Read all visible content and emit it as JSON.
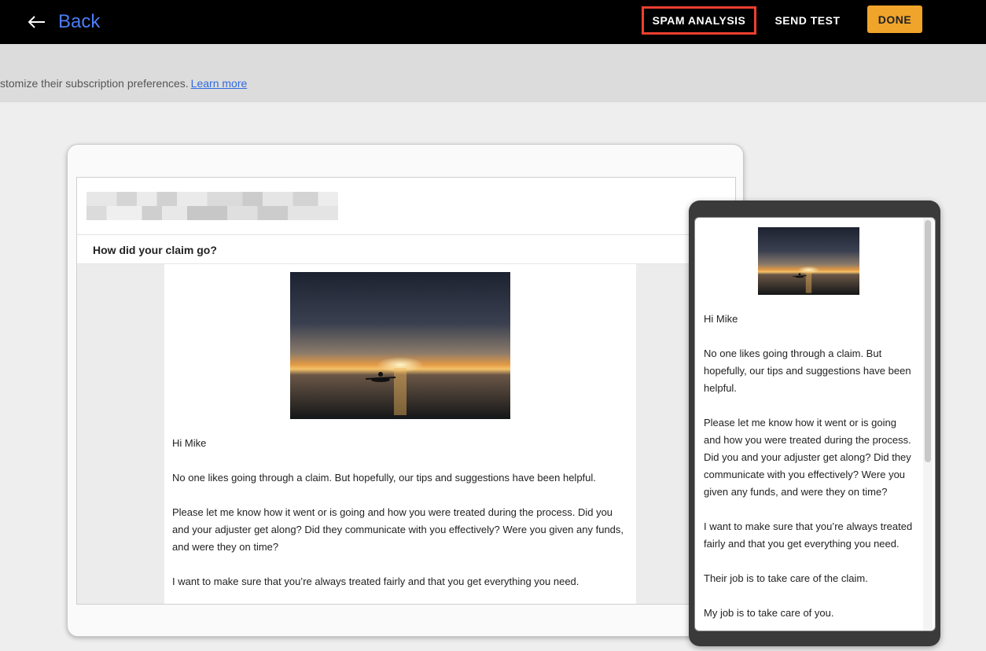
{
  "topbar": {
    "back_label": "Back",
    "spam_label": "SPAM ANALYSIS",
    "send_test_label": "SEND TEST",
    "done_label": "DONE"
  },
  "notice": {
    "text": "stomize their subscription preferences.",
    "link_label": "Learn more"
  },
  "email": {
    "subject": "How did your claim go?",
    "greeting": "Hi Mike",
    "paragraphs": [
      "No one likes going through a claim. But hopefully, our tips and suggestions have been helpful.",
      "Please let me know how it went or is going and how you were treated during the process. Did you and your adjuster get along? Did they communicate with you effectively? Were you given any funds, and were they on time?",
      "I want to make sure that you’re always treated fairly and that you get everything you need.",
      "Their job is to take care of the claim.",
      "My job is to take care of you."
    ]
  },
  "colors": {
    "accent_blue": "#4d7cf7",
    "done_orange": "#f0a42a",
    "highlight_red": "#ef3f2f"
  }
}
